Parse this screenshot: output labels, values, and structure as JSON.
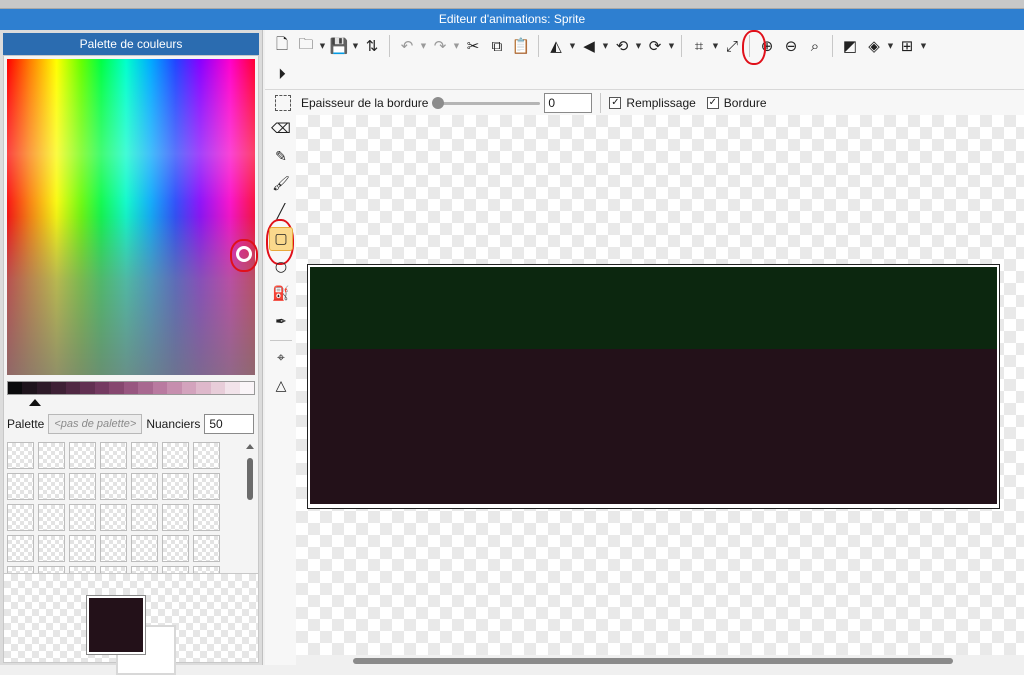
{
  "window": {
    "title": "Editeur d'animations: Sprite"
  },
  "palette_panel": {
    "header": "Palette de couleurs",
    "palette_label": "Palette",
    "palette_select": "<pas de palette>",
    "nuances_label": "Nuanciers",
    "nuances_value": "50",
    "shades": [
      "#0a0a0c",
      "#1e141c",
      "#2d1a28",
      "#3e2035",
      "#502843",
      "#623052",
      "#743a61",
      "#86476f",
      "#985680",
      "#a86890",
      "#b97aa0",
      "#c68eae",
      "#d3a3bd",
      "#deb8cb",
      "#e8cdd9",
      "#f2e3ea",
      "#faf5f8"
    ],
    "primary_color": "#231119",
    "secondary_color": "#ffffff"
  },
  "toolbar": {
    "row1": [
      {
        "icon": "new-file-icon",
        "glyph": "🗋"
      },
      {
        "icon": "open-folder-icon",
        "glyph": "🗀",
        "dropdown": true
      },
      {
        "icon": "save-icon",
        "glyph": "💾",
        "dropdown": true
      },
      {
        "icon": "import-icon",
        "glyph": "⇅"
      },
      {
        "sep": true
      },
      {
        "icon": "undo-icon",
        "glyph": "↶",
        "dropdown": true,
        "disabled": true
      },
      {
        "icon": "redo-icon",
        "glyph": "↷",
        "dropdown": true,
        "disabled": true
      },
      {
        "icon": "cut-icon",
        "glyph": "✂"
      },
      {
        "icon": "copy-icon",
        "glyph": "⧉"
      },
      {
        "icon": "paste-icon",
        "glyph": "📋"
      },
      {
        "sep": true
      },
      {
        "icon": "flip-horizontal-icon",
        "glyph": "◭",
        "dropdown": true
      },
      {
        "icon": "flip-vertical-icon",
        "glyph": "◀",
        "dropdown": true
      },
      {
        "icon": "rotate-left-icon",
        "glyph": "⟲",
        "dropdown": true
      },
      {
        "icon": "rotate-right-icon",
        "glyph": "⟳",
        "dropdown": true
      },
      {
        "sep": true
      },
      {
        "icon": "crop-icon",
        "glyph": "⌗",
        "dropdown": true
      },
      {
        "icon": "resize-icon",
        "glyph": "⤢"
      },
      {
        "sep": true
      },
      {
        "icon": "zoom-in-icon",
        "glyph": "⊕"
      },
      {
        "icon": "zoom-out-icon",
        "glyph": "⊖"
      },
      {
        "icon": "zoom-reset-icon",
        "glyph": "⌕"
      },
      {
        "sep": true
      },
      {
        "icon": "transparency-icon",
        "glyph": "◩"
      },
      {
        "icon": "layers-icon",
        "glyph": "◈",
        "dropdown": true
      },
      {
        "icon": "grid-icon",
        "glyph": "⊞",
        "dropdown": true
      }
    ],
    "row2": [
      {
        "icon": "play-icon",
        "glyph": "⏵"
      }
    ]
  },
  "options_bar": {
    "border_width_label": "Epaisseur de la bordure",
    "border_width_value": "0",
    "fill_label": "Remplissage",
    "fill_checked": true,
    "border_label": "Bordure",
    "border_checked": true
  },
  "tools": [
    {
      "icon": "eraser-icon",
      "glyph": "⌫"
    },
    {
      "icon": "pencil-icon",
      "glyph": "✎"
    },
    {
      "icon": "brush-icon",
      "glyph": "🖌"
    },
    {
      "icon": "line-icon",
      "glyph": "╱"
    },
    {
      "icon": "rectangle-icon",
      "glyph": "▢",
      "active": true
    },
    {
      "icon": "ellipse-icon",
      "glyph": "○"
    },
    {
      "icon": "fill-bucket-icon",
      "glyph": "⛽"
    },
    {
      "icon": "eyedropper-icon",
      "glyph": "✒"
    },
    {
      "sep": true
    },
    {
      "icon": "origin-point-icon",
      "glyph": "⌖"
    },
    {
      "icon": "polygon-points-icon",
      "glyph": "△"
    }
  ],
  "sprite": {
    "top_color": "#0c270f",
    "bottom_color": "#231119"
  },
  "colors": {
    "title_bar": "#2e7fd0",
    "panel_header": "#2b6cb0",
    "active_tool": "#fbd98c",
    "annotation": "#e0101a"
  }
}
